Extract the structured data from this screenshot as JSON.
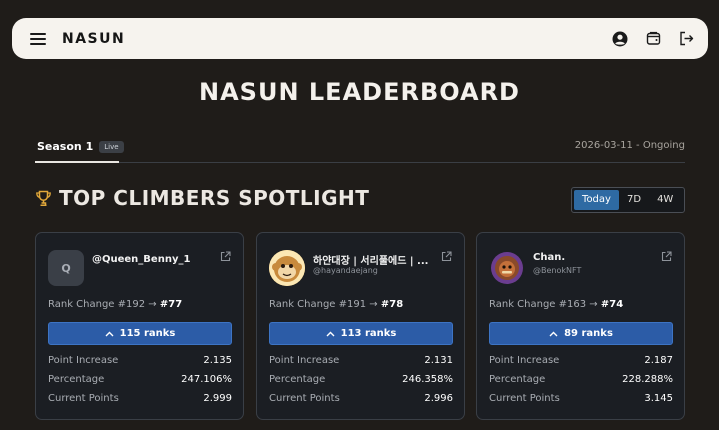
{
  "header": {
    "logo": "NASUN",
    "icons": [
      "menu-icon",
      "profile-icon",
      "wallet-icon",
      "logout-icon"
    ]
  },
  "page": {
    "title": "NASUN LEADERBOARD"
  },
  "season": {
    "tab_label": "Season 1",
    "badge": "Live",
    "date_range": "2026-03-11 - Ongoing"
  },
  "spotlight": {
    "title": "TOP CLIMBERS SPOTLIGHT",
    "icon": "trophy-icon",
    "periods": [
      "Today",
      "7D",
      "4W"
    ],
    "active_period": "Today"
  },
  "colors": {
    "accent": "#2e6aa3",
    "background": "#1f1c19",
    "card": "#1b1e23",
    "trophy": "#e3a93a"
  },
  "labels": {
    "rank_change": "Rank Change",
    "point_increase": "Point Increase",
    "percentage": "Percentage",
    "current_points": "Current Points"
  },
  "cards": [
    {
      "name": "@Queen_Benny_1",
      "handle": "",
      "avatar_letter": "Q",
      "rank_from": "#192",
      "arrow": "→",
      "rank_to": "#77",
      "ranks_up": "115 ranks",
      "point_increase": "2.135",
      "percentage": "247.106%",
      "current_points": "2.999"
    },
    {
      "name": "하얀대장 | 서리풀에드 | ...",
      "handle": "@hayandaejang",
      "avatar_letter": "",
      "rank_from": "#191",
      "arrow": "→",
      "rank_to": "#78",
      "ranks_up": "113 ranks",
      "point_increase": "2.131",
      "percentage": "246.358%",
      "current_points": "2.996"
    },
    {
      "name": "Chan.",
      "handle": "@BenokNFT",
      "avatar_letter": "",
      "rank_from": "#163",
      "arrow": "→",
      "rank_to": "#74",
      "ranks_up": "89 ranks",
      "point_increase": "2.187",
      "percentage": "228.288%",
      "current_points": "3.145"
    }
  ]
}
